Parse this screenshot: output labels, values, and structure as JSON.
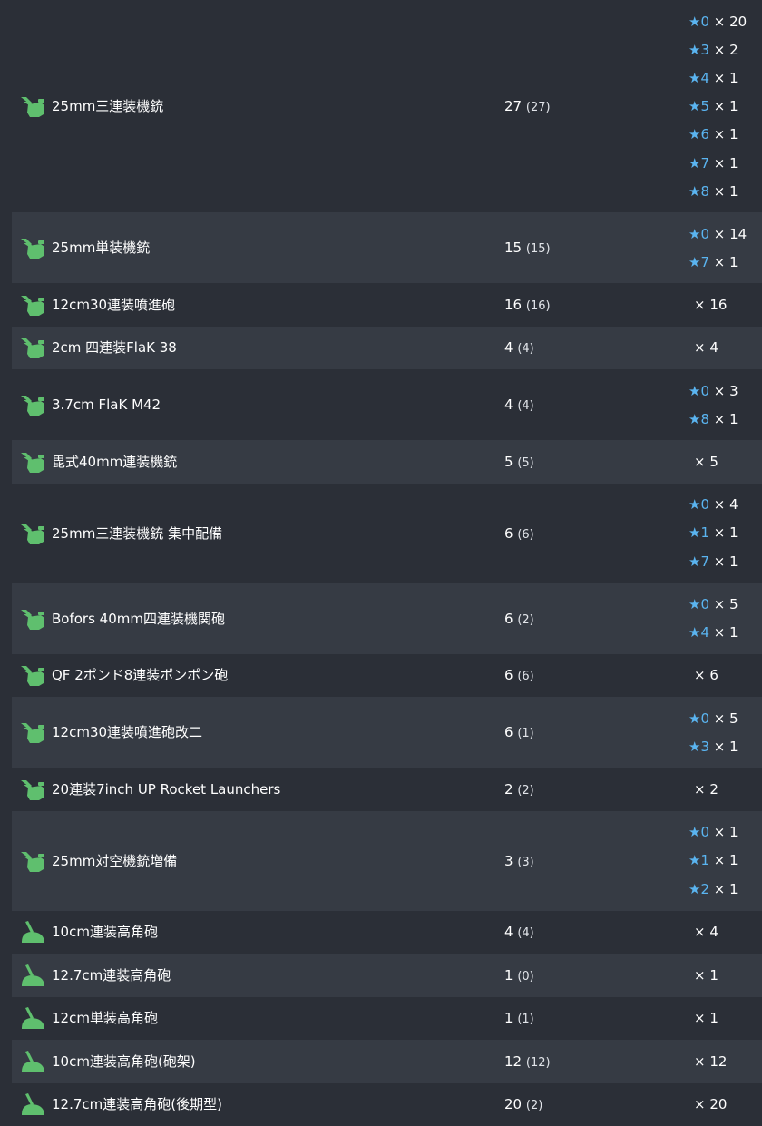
{
  "colors": {
    "background": "#2b2f37",
    "row_alt": "#363b44",
    "icon_green": "#5fbf6e",
    "star_blue": "#5ab4f0"
  },
  "icons": {
    "aa_gun": "aa-gun-icon",
    "high_angle_gun": "high-angle-gun-icon"
  },
  "rows": [
    {
      "name": "25mm三連装機銃",
      "icon": "aa",
      "count": "27",
      "sub": "(27)",
      "improvements": [
        {
          "star": "★",
          "lvl": "0",
          "times": " × 20"
        },
        {
          "star": "★",
          "lvl": "3",
          "times": " × 2"
        },
        {
          "star": "★",
          "lvl": "4",
          "times": " × 1"
        },
        {
          "star": "★",
          "lvl": "5",
          "times": " × 1"
        },
        {
          "star": "★",
          "lvl": "6",
          "times": " × 1"
        },
        {
          "star": "★",
          "lvl": "7",
          "times": " × 1"
        },
        {
          "star": "★",
          "lvl": "8",
          "times": " × 1"
        }
      ]
    },
    {
      "name": "25mm単装機銃",
      "icon": "aa",
      "count": "15",
      "sub": "(15)",
      "improvements": [
        {
          "star": "★",
          "lvl": "0",
          "times": " × 14"
        },
        {
          "star": "★",
          "lvl": "7",
          "times": " × 1"
        }
      ]
    },
    {
      "name": "12cm30連装噴進砲",
      "icon": "aa",
      "count": "16",
      "sub": "(16)",
      "improvements": [
        {
          "star": "",
          "lvl": "",
          "times": "× 16"
        }
      ]
    },
    {
      "name": "2cm 四連装FlaK 38",
      "icon": "aa",
      "count": "4",
      "sub": "(4)",
      "improvements": [
        {
          "star": "",
          "lvl": "",
          "times": "× 4"
        }
      ]
    },
    {
      "name": "3.7cm FlaK M42",
      "icon": "aa",
      "count": "4",
      "sub": "(4)",
      "improvements": [
        {
          "star": "★",
          "lvl": "0",
          "times": " × 3"
        },
        {
          "star": "★",
          "lvl": "8",
          "times": " × 1"
        }
      ]
    },
    {
      "name": "毘式40mm連装機銃",
      "icon": "aa",
      "count": "5",
      "sub": "(5)",
      "improvements": [
        {
          "star": "",
          "lvl": "",
          "times": "× 5"
        }
      ]
    },
    {
      "name": "25mm三連装機銃 集中配備",
      "icon": "aa",
      "count": "6",
      "sub": "(6)",
      "improvements": [
        {
          "star": "★",
          "lvl": "0",
          "times": " × 4"
        },
        {
          "star": "★",
          "lvl": "1",
          "times": " × 1"
        },
        {
          "star": "★",
          "lvl": "7",
          "times": " × 1"
        }
      ]
    },
    {
      "name": "Bofors 40mm四連装機関砲",
      "icon": "aa",
      "count": "6",
      "sub": "(2)",
      "improvements": [
        {
          "star": "★",
          "lvl": "0",
          "times": " × 5"
        },
        {
          "star": "★",
          "lvl": "4",
          "times": " × 1"
        }
      ]
    },
    {
      "name": "QF 2ポンド8連装ポンポン砲",
      "icon": "aa",
      "count": "6",
      "sub": "(6)",
      "improvements": [
        {
          "star": "",
          "lvl": "",
          "times": "× 6"
        }
      ]
    },
    {
      "name": "12cm30連装噴進砲改二",
      "icon": "aa",
      "count": "6",
      "sub": "(1)",
      "improvements": [
        {
          "star": "★",
          "lvl": "0",
          "times": " × 5"
        },
        {
          "star": "★",
          "lvl": "3",
          "times": " × 1"
        }
      ]
    },
    {
      "name": "20連装7inch UP Rocket Launchers",
      "icon": "aa",
      "count": "2",
      "sub": "(2)",
      "improvements": [
        {
          "star": "",
          "lvl": "",
          "times": "× 2"
        }
      ]
    },
    {
      "name": "25mm対空機銃増備",
      "icon": "aa",
      "count": "3",
      "sub": "(3)",
      "improvements": [
        {
          "star": "★",
          "lvl": "0",
          "times": " × 1"
        },
        {
          "star": "★",
          "lvl": "1",
          "times": " × 1"
        },
        {
          "star": "★",
          "lvl": "2",
          "times": " × 1"
        }
      ]
    },
    {
      "name": "10cm連装高角砲",
      "icon": "ha",
      "count": "4",
      "sub": "(4)",
      "improvements": [
        {
          "star": "",
          "lvl": "",
          "times": "× 4"
        }
      ]
    },
    {
      "name": "12.7cm連装高角砲",
      "icon": "ha",
      "count": "1",
      "sub": "(0)",
      "improvements": [
        {
          "star": "",
          "lvl": "",
          "times": "× 1"
        }
      ]
    },
    {
      "name": "12cm単装高角砲",
      "icon": "ha",
      "count": "1",
      "sub": "(1)",
      "improvements": [
        {
          "star": "",
          "lvl": "",
          "times": "× 1"
        }
      ]
    },
    {
      "name": "10cm連装高角砲(砲架)",
      "icon": "ha",
      "count": "12",
      "sub": "(12)",
      "improvements": [
        {
          "star": "",
          "lvl": "",
          "times": "× 12"
        }
      ]
    },
    {
      "name": "12.7cm連装高角砲(後期型)",
      "icon": "ha",
      "count": "20",
      "sub": "(2)",
      "improvements": [
        {
          "star": "",
          "lvl": "",
          "times": "× 20"
        }
      ]
    }
  ]
}
